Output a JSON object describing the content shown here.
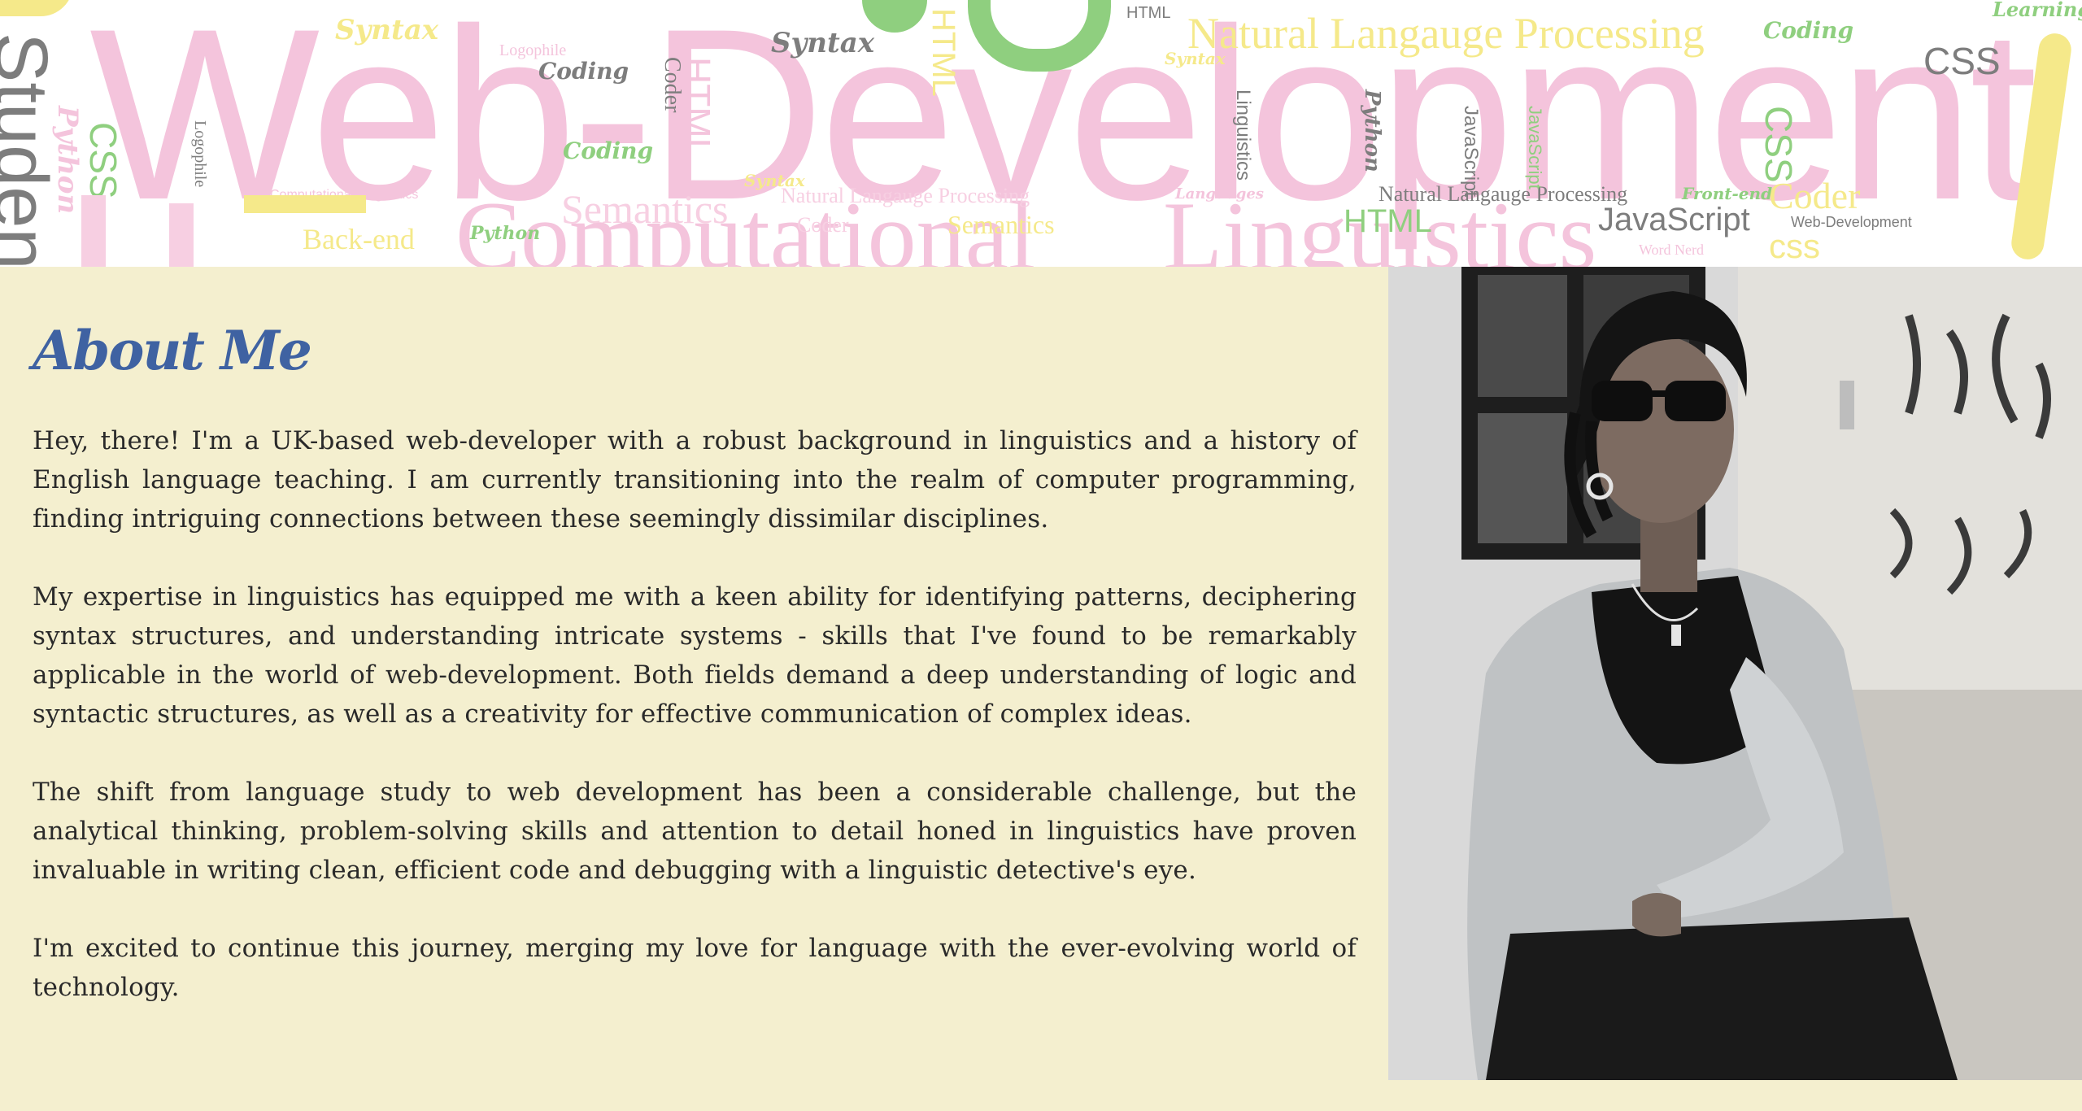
{
  "banner": {
    "words": {
      "web_dev_big": "Web-Development",
      "computational": "Computational",
      "linguistics": "Linguistics",
      "student": "Student",
      "natural": "Natural Langauge Processing",
      "natural2": "Natural Langauge Processing",
      "natural3": "Natural Langauge Processing",
      "semantics": "Semantics",
      "semantics2": "Semantics",
      "coder": "Coder",
      "coder2": "Coder",
      "coder3": "Coder",
      "backend": "Back-end",
      "frontend": "Front-end",
      "html": "HTML",
      "html2": "HTML",
      "html3": "HTML",
      "html4": "HTML",
      "javascript": "JavaScript",
      "javascript2": "JavaScript",
      "javascript3": "JavaScript",
      "css": "CSS",
      "css2": "CSS",
      "css3": "CSS",
      "css4": "css",
      "syntax": "Syntax",
      "syntax2": "Syntax",
      "syntax3": "Syntax",
      "syntax4": "Syntax",
      "coding": "Coding",
      "coding2": "Coding",
      "coding3": "Coding",
      "python": "Python",
      "python2": "Python",
      "python3": "Python",
      "logophile": "Logophile",
      "logophile2": "Logophile",
      "languages": "Languages",
      "word_nerd": "Word Nerd",
      "webdev_small": "Web-Development",
      "linguistics_small": "Linguistics",
      "learning": "Learning",
      "comp_ling_small": "Computational Linguistics"
    }
  },
  "about": {
    "title": "About Me",
    "paragraphs": [
      "Hey, there! I'm a UK-based web-developer with a robust background in linguistics and a history of English language teaching. I am currently transitioning into the realm of computer programming, finding intriguing connections between these seemingly dissimilar disciplines.",
      "My expertise in linguistics has equipped me with a keen ability for identifying patterns, deciphering syntax structures, and understanding intricate systems - skills that I've found to be remarkably applicable in the world of web-development. Both fields demand a deep understanding of logic and syntactic structures, as well as a creativity for effective communication of complex ideas.",
      "The shift from language study to web development has been a considerable challenge, but the analytical thinking, problem-solving skills and attention to detail honed in linguistics have proven invaluable in writing clean, efficient code and debugging with a linguistic detective's eye.",
      "I'm excited to continue this journey, merging my love for language with the ever-evolving world of technology."
    ]
  },
  "photo": {
    "style": "black-and-white portrait"
  },
  "colors": {
    "background": "#f4efcf",
    "title": "#3f62a2",
    "cloud_pink": "#f4c4dc",
    "cloud_yellow": "#f5e98a",
    "cloud_green": "#8fcf7f",
    "cloud_grey": "#7d7d7d"
  }
}
